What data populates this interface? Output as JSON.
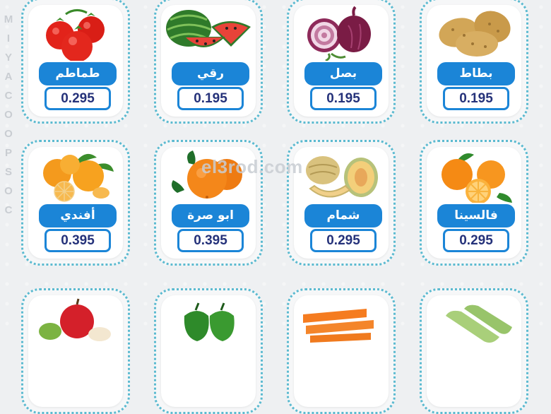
{
  "side_letters": [
    "M",
    "I",
    "Y",
    "A",
    "C",
    "O",
    "O",
    "P",
    "S",
    "O",
    "C"
  ],
  "watermark": "el3rod.com",
  "products": [
    {
      "name": "طماطم",
      "price": "0.295",
      "icon": "tomato-icon"
    },
    {
      "name": "رقي",
      "price": "0.195",
      "icon": "watermelon-icon"
    },
    {
      "name": "بصل",
      "price": "0.195",
      "icon": "onion-icon"
    },
    {
      "name": "بطاط",
      "price": "0.195",
      "icon": "potato-icon"
    },
    {
      "name": "أفندي",
      "price": "0.395",
      "icon": "tangerine-icon"
    },
    {
      "name": "ابو صرة",
      "price": "0.395",
      "icon": "navel-orange-icon"
    },
    {
      "name": "شمام",
      "price": "0.295",
      "icon": "cantaloupe-icon"
    },
    {
      "name": "فالسينا",
      "price": "0.295",
      "icon": "valencia-orange-icon"
    }
  ],
  "partial_row_icons": [
    "apple-icon",
    "bell-pepper-icon",
    "carrot-icon",
    "zucchini-icon"
  ]
}
